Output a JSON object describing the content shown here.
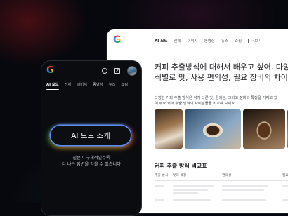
{
  "desktop": {
    "logo": "G",
    "tabs": [
      "AI 모드",
      "전체",
      "이미지",
      "동영상",
      "뉴스",
      "쇼핑"
    ],
    "more_label": "더보기",
    "heading_lines": [
      "커피 추출방식에 대해서 배우고 싶어. 다양한",
      "식별로 맛, 사용 편의성, 필요 장비의 차이점을"
    ],
    "description_lines": [
      "다양한 커피 추출 방식은 각기 다른 맛, 편의성, 그리고 장비의 특징을 가지고 있",
      "예 주요 커피 추출 방식의 차이점들을 비교해 보세요."
    ],
    "section_title": "커피 추출 방식 비교표",
    "table_headers": [
      "추출 방식",
      "맛의 특징",
      "편의성",
      "필요"
    ]
  },
  "phone": {
    "logo": "G",
    "tabs": [
      "AI 모드",
      "전체",
      "이미지",
      "동영상",
      "뉴스",
      "쇼핑"
    ],
    "cta_label": "AI 모드 소개",
    "subtitle_lines": [
      "질문이 구체적일수록",
      "더 나은 답변을 얻을 수 있습니다"
    ]
  },
  "colors": {
    "google_blue": "#4285F4",
    "google_red": "#EA4335",
    "google_yellow": "#FBBC05",
    "google_green": "#34A853"
  }
}
